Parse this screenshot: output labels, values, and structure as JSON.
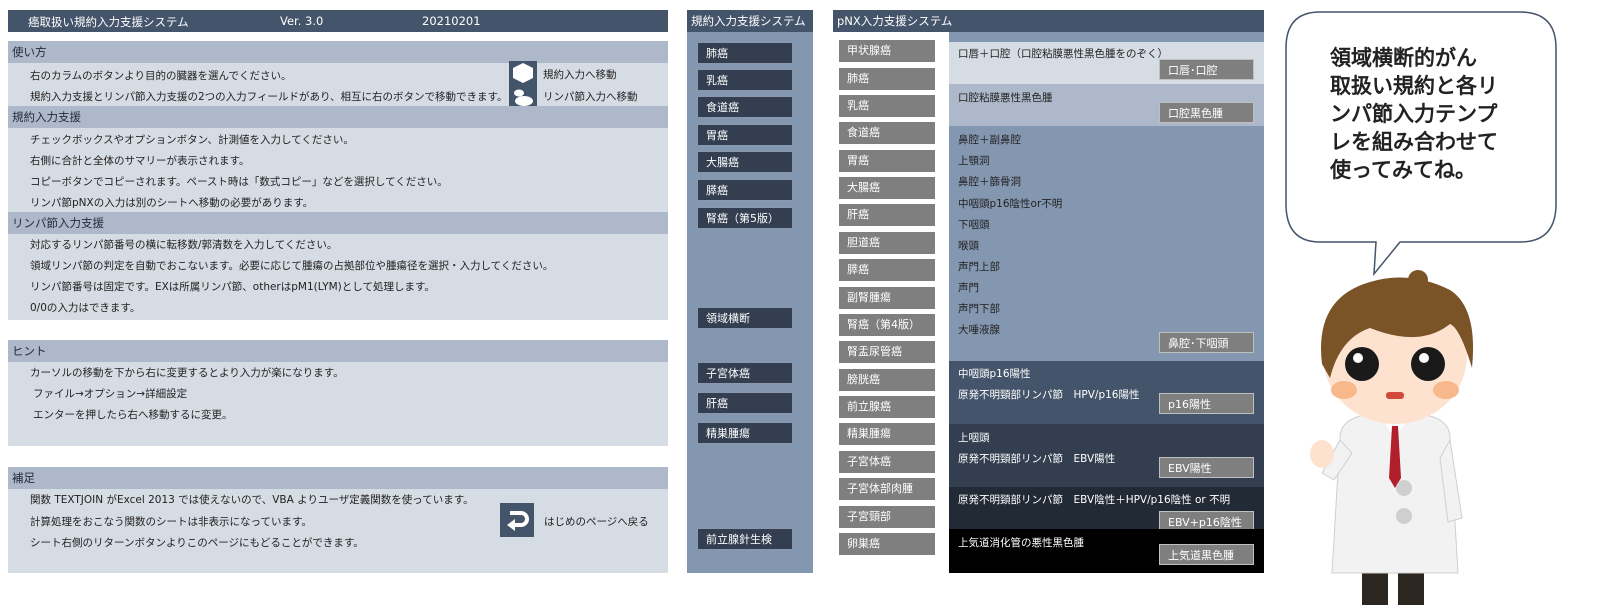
{
  "header": {
    "title": "癌取扱い規約入力支援システム",
    "version": "Ver. 3.0",
    "date": "20210201"
  },
  "usage": {
    "heading": "使い方",
    "lines": [
      "右のカラムのボタンより目的の臓器を選んでください。",
      "規約入力支援とリンパ節入力支援の2つの入力フィールドがあり、相互に右のボタンで移動できます。"
    ],
    "links": [
      "規約入力へ移動",
      "リンパ節入力へ移動"
    ]
  },
  "kiyaku_help": {
    "heading": "規約入力支援",
    "lines": [
      "チェックボックスやオプションボタン、計測値を入力してください。",
      "右側に合計と全体のサマリーが表示されます。",
      "コピーボタンでコピーされます。ペースト時は「数式コピー」などを選択してください。",
      "リンパ節pNXの入力は別のシートへ移動の必要があります。"
    ]
  },
  "lymph_help": {
    "heading": "リンパ節入力支援",
    "lines": [
      "対応するリンパ節番号の横に転移数/郭清数を入力してください。",
      "領域リンパ節の判定を自動でおこないます。必要に応じて腫瘍の占拠部位や腫瘍径を選択・入力してください。",
      "リンパ節番号は固定です。EXは所属リンパ節、otherはpM1(LYM)として処理します。",
      "0/0の入力はできます。"
    ]
  },
  "hint": {
    "heading": "ヒント",
    "lines": [
      "カーソルの移動を下から右に変更するとより入力が楽になります。",
      "ファイル→オプション→詳細設定",
      "エンターを押したら右へ移動するに変更。"
    ]
  },
  "supplement": {
    "heading": "補足",
    "lines": [
      "関数 TEXTJOIN がExcel 2013 では使えないので、VBA よりユーザ定義関数を使っています。",
      "計算処理をおこなう関数のシートは非表示になっています。",
      "シート右側のリターンボタンよりこのページにもどることができます。"
    ],
    "return_label": "はじめのページへ戻る"
  },
  "kiyaku_panel": {
    "title": "規約入力支援システム",
    "buttons": [
      "肺癌",
      "乳癌",
      "食道癌",
      "胃癌",
      "大腸癌",
      "膵癌",
      "腎癌（第5版）",
      "領域横断",
      "子宮体癌",
      "肝癌",
      "精巣腫瘍",
      "前立腺針生検"
    ]
  },
  "pnx_panel": {
    "title": "pNX入力支援システム",
    "buttons": [
      "甲状腺癌",
      "肺癌",
      "乳癌",
      "食道癌",
      "胃癌",
      "大腸癌",
      "肝癌",
      "胆道癌",
      "膵癌",
      "副腎腫瘍",
      "腎癌（第4版）",
      "腎盂尿管癌",
      "膀胱癌",
      "前立腺癌",
      "精巣腫瘍",
      "子宮体癌",
      "子宮体部肉腫",
      "子宮頸部",
      "卵巣癌"
    ],
    "bands": [
      {
        "lines": [
          "口唇＋口腔（口腔粘膜悪性黒色腫をのぞく）"
        ],
        "button": "口唇･口腔"
      },
      {
        "lines": [
          "口腔粘膜悪性黒色腫"
        ],
        "button": "口腔黒色腫"
      },
      {
        "lines": [
          "鼻腔＋副鼻腔",
          " 上顎洞",
          " 鼻腔＋篩骨洞",
          "中咽頭p16陰性or不明",
          "下咽頭",
          "喉頭",
          " 声門上部",
          " 声門",
          " 声門下部",
          "大唾液腺"
        ],
        "button": "鼻腔･下咽頭"
      },
      {
        "lines": [
          "中咽頭p16陽性",
          "原発不明頸部リンパ節　HPV/p16陽性"
        ],
        "button": "p16陽性"
      },
      {
        "lines": [
          "上咽頭",
          "原発不明頸部リンパ節　EBV陽性"
        ],
        "button": "EBV陽性"
      },
      {
        "lines": [
          "原発不明頸部リンパ節　EBV陰性＋HPV/p16陰性 or 不明"
        ],
        "button": "EBV+p16陰性"
      },
      {
        "lines": [
          "上気道消化管の悪性黒色腫"
        ],
        "button": "上気道黒色腫"
      }
    ]
  },
  "bubble": {
    "lines": [
      "領域横断的がん",
      "取扱い規約と各リ",
      "ンパ節入力テンプ",
      "レを組み合わせて",
      "使ってみてね。"
    ]
  }
}
